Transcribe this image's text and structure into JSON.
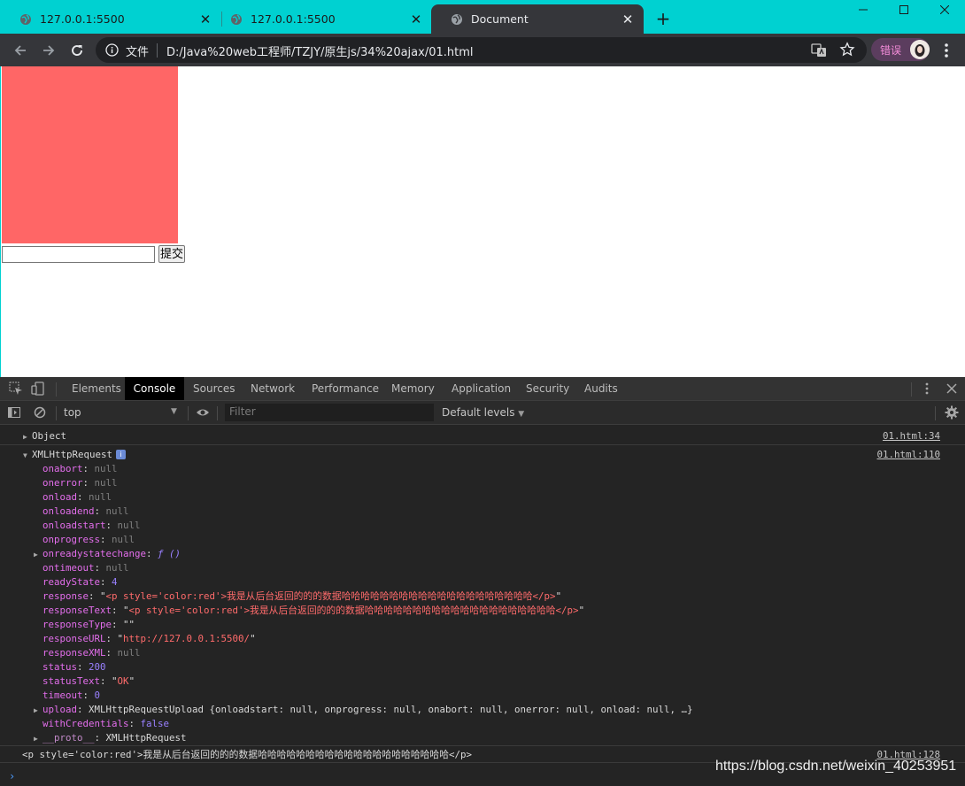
{
  "tabs": [
    {
      "title": "127.0.0.1:5500",
      "active": false
    },
    {
      "title": "127.0.0.1:5500",
      "active": false
    },
    {
      "title": "Document",
      "active": true
    }
  ],
  "toolbar": {
    "security_label": "文件",
    "url": "D:/Java%20web工程师/TZJY/原生js/34%20ajax/01.html",
    "profile_label": "错误"
  },
  "page": {
    "box_color": "#ff6666",
    "input_value": "",
    "submit_label": "提交"
  },
  "devtools": {
    "tabs": [
      "Elements",
      "Console",
      "Sources",
      "Network",
      "Performance",
      "Memory",
      "Application",
      "Security",
      "Audits"
    ],
    "active_tab": "Console",
    "context": "top",
    "filter_placeholder": "Filter",
    "levels_label": "Default levels"
  },
  "console": {
    "entries": [
      {
        "label": "Object",
        "source": "01.html:34"
      },
      {
        "label": "XMLHttpRequest",
        "badge": "i",
        "source": "01.html:110"
      },
      {
        "label": "<p style='color:red'>我是从后台返回的的的数据哈哈哈哈哈哈哈哈哈哈哈哈哈哈哈哈哈哈哈哈</p>",
        "source": "01.html:128"
      }
    ],
    "xhr_props": [
      {
        "key": "onabort",
        "value": "null",
        "type": "null"
      },
      {
        "key": "onerror",
        "value": "null",
        "type": "null"
      },
      {
        "key": "onload",
        "value": "null",
        "type": "null"
      },
      {
        "key": "onloadend",
        "value": "null",
        "type": "null"
      },
      {
        "key": "onloadstart",
        "value": "null",
        "type": "null"
      },
      {
        "key": "onprogress",
        "value": "null",
        "type": "null"
      },
      {
        "key": "onreadystatechange",
        "value": "ƒ ()",
        "type": "fn",
        "expandable": true
      },
      {
        "key": "ontimeout",
        "value": "null",
        "type": "null"
      },
      {
        "key": "readyState",
        "value": "4",
        "type": "num"
      },
      {
        "key": "response",
        "value": "<p style='color:red'>我是从后台返回的的的数据哈哈哈哈哈哈哈哈哈哈哈哈哈哈哈哈哈哈哈哈</p>",
        "type": "str"
      },
      {
        "key": "responseText",
        "value": "<p style='color:red'>我是从后台返回的的的数据哈哈哈哈哈哈哈哈哈哈哈哈哈哈哈哈哈哈哈哈</p>",
        "type": "str"
      },
      {
        "key": "responseType",
        "value": "",
        "type": "str"
      },
      {
        "key": "responseURL",
        "value": "http://127.0.0.1:5500/",
        "type": "str"
      },
      {
        "key": "responseXML",
        "value": "null",
        "type": "null"
      },
      {
        "key": "status",
        "value": "200",
        "type": "num"
      },
      {
        "key": "statusText",
        "value": "OK",
        "type": "str"
      },
      {
        "key": "timeout",
        "value": "0",
        "type": "num"
      },
      {
        "key": "upload",
        "value": "XMLHttpRequestUpload {onloadstart: null, onprogress: null, onabort: null, onerror: null, onload: null, …}",
        "type": "obj",
        "expandable": true
      },
      {
        "key": "withCredentials",
        "value": "false",
        "type": "num"
      },
      {
        "key": "__proto__",
        "value": "XMLHttpRequest",
        "type": "proto",
        "expandable": true
      }
    ]
  },
  "watermark": "https://blog.csdn.net/weixin_40253951"
}
